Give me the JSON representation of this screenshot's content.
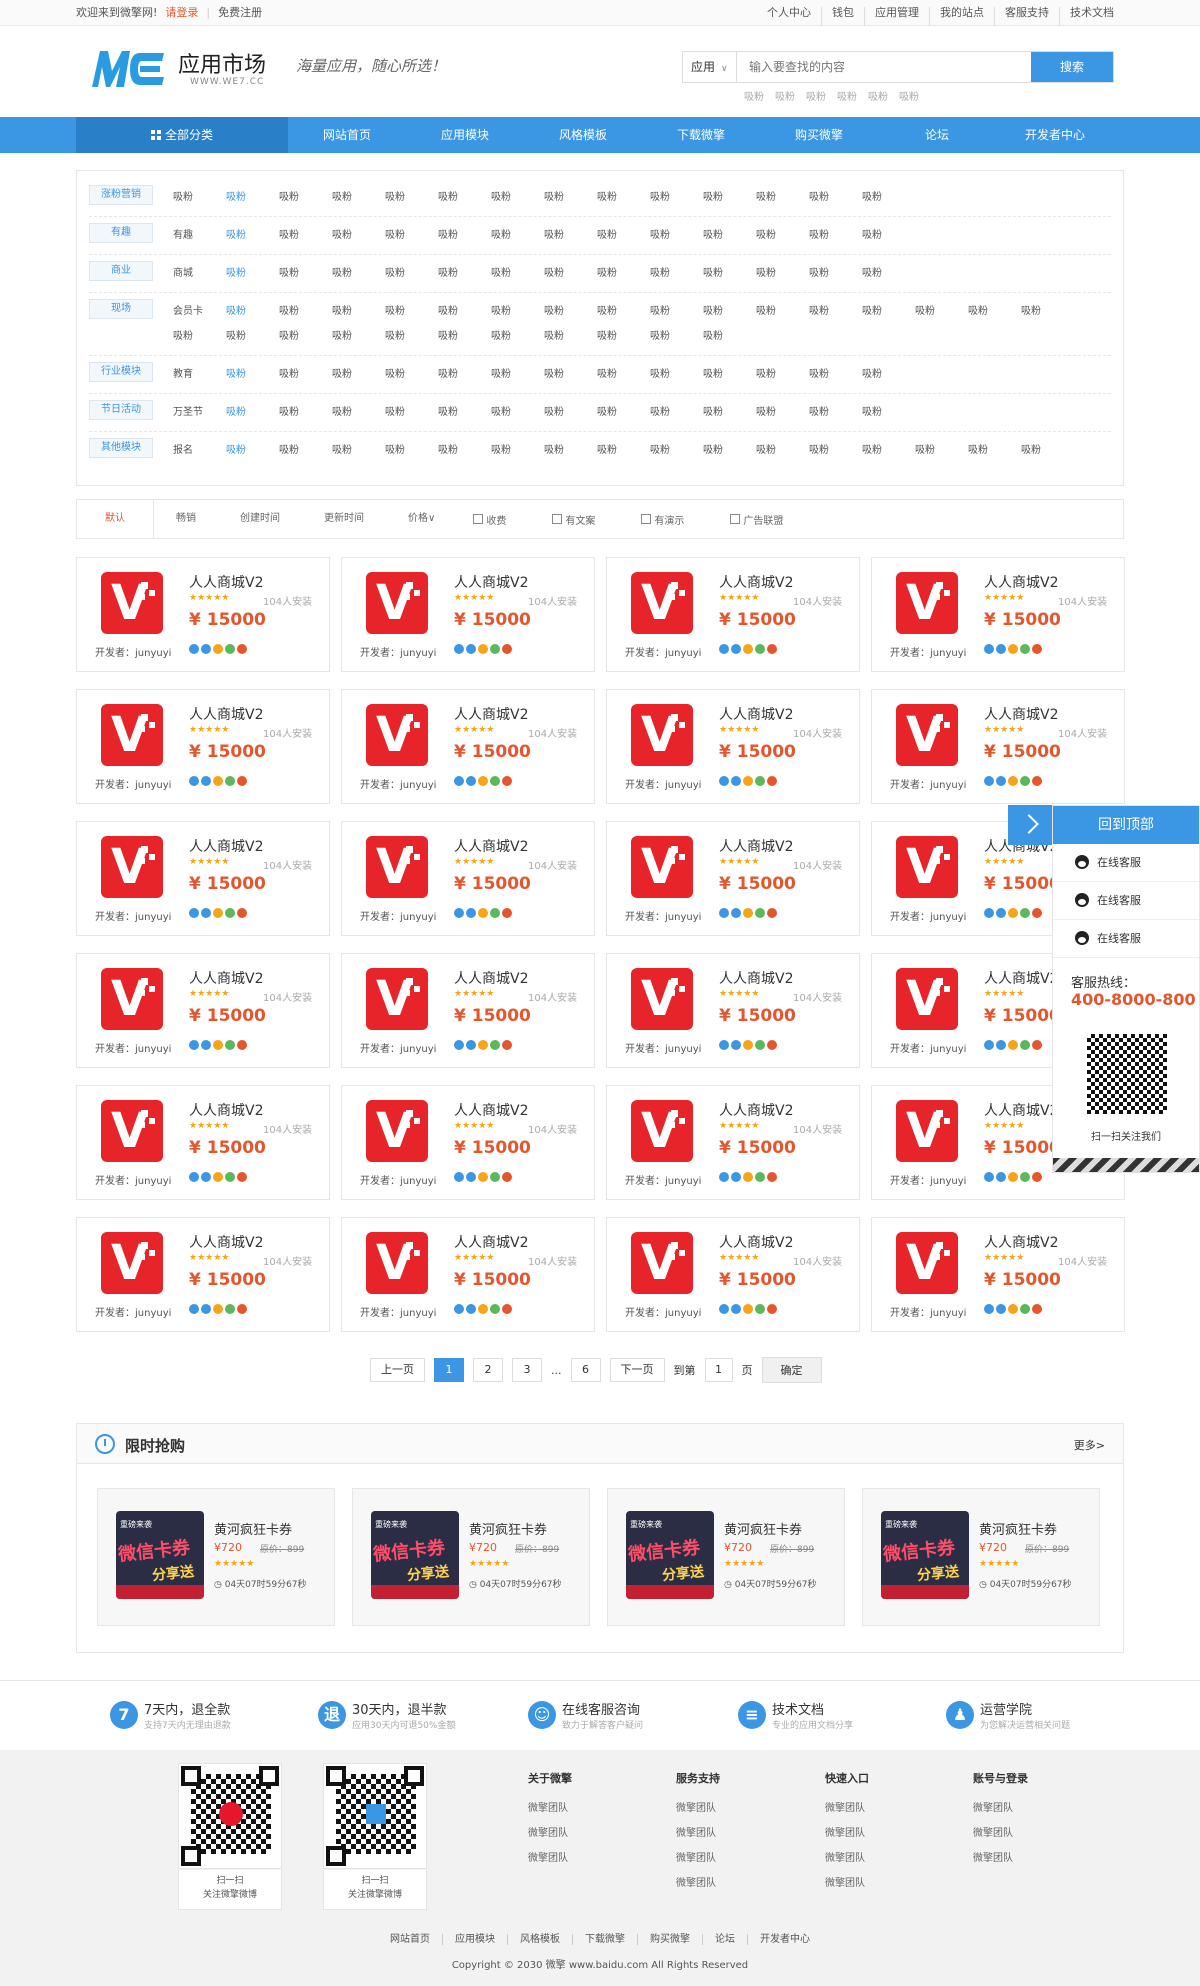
{
  "topbar": {
    "welcome": "欢迎来到微擎网!",
    "login": "请登录",
    "register": "免费注册",
    "links": [
      "个人中心",
      "钱包",
      "应用管理",
      "我的站点",
      "客服支持",
      "技术文档"
    ]
  },
  "header": {
    "logo_text": "应用市场",
    "logo_sub": "WWW.WE7.CC",
    "slogan": "海量应用，随心所选！",
    "search_select": "应用",
    "search_placeholder": "输入要查找的内容",
    "search_button": "搜索",
    "hotwords": [
      "吸粉",
      "吸粉",
      "吸粉",
      "吸粉",
      "吸粉",
      "吸粉"
    ]
  },
  "nav": {
    "items": [
      "全部分类",
      "网站首页",
      "应用模块",
      "风格模板",
      "下载微擎",
      "购买微擎",
      "论坛",
      "开发者中心"
    ]
  },
  "categories": [
    {
      "label": "涨粉营销",
      "items": [
        "吸粉",
        "吸粉",
        "吸粉",
        "吸粉",
        "吸粉",
        "吸粉",
        "吸粉",
        "吸粉",
        "吸粉",
        "吸粉",
        "吸粉",
        "吸粉",
        "吸粉",
        "吸粉"
      ]
    },
    {
      "label": "有趣",
      "items": [
        "有趣",
        "吸粉",
        "吸粉",
        "吸粉",
        "吸粉",
        "吸粉",
        "吸粉",
        "吸粉",
        "吸粉",
        "吸粉",
        "吸粉",
        "吸粉",
        "吸粉",
        "吸粉"
      ]
    },
    {
      "label": "商业",
      "items": [
        "商城",
        "吸粉",
        "吸粉",
        "吸粉",
        "吸粉",
        "吸粉",
        "吸粉",
        "吸粉",
        "吸粉",
        "吸粉",
        "吸粉",
        "吸粉",
        "吸粉",
        "吸粉"
      ]
    },
    {
      "label": "现场",
      "items": [
        "会员卡",
        "吸粉",
        "吸粉",
        "吸粉",
        "吸粉",
        "吸粉",
        "吸粉",
        "吸粉",
        "吸粉",
        "吸粉",
        "吸粉",
        "吸粉",
        "吸粉",
        "吸粉",
        "吸粉",
        "吸粉",
        "吸粉",
        "吸粉",
        "吸粉",
        "吸粉",
        "吸粉",
        "吸粉",
        "吸粉",
        "吸粉",
        "吸粉",
        "吸粉",
        "吸粉",
        "吸粉"
      ]
    },
    {
      "label": "行业模块",
      "items": [
        "教育",
        "吸粉",
        "吸粉",
        "吸粉",
        "吸粉",
        "吸粉",
        "吸粉",
        "吸粉",
        "吸粉",
        "吸粉",
        "吸粉",
        "吸粉",
        "吸粉",
        "吸粉"
      ]
    },
    {
      "label": "节日活动",
      "items": [
        "万圣节",
        "吸粉",
        "吸粉",
        "吸粉",
        "吸粉",
        "吸粉",
        "吸粉",
        "吸粉",
        "吸粉",
        "吸粉",
        "吸粉",
        "吸粉",
        "吸粉",
        "吸粉"
      ]
    },
    {
      "label": "其他模块",
      "items": [
        "报名",
        "吸粉",
        "吸粉",
        "吸粉",
        "吸粉",
        "吸粉",
        "吸粉",
        "吸粉",
        "吸粉",
        "吸粉",
        "吸粉",
        "吸粉",
        "吸粉",
        "吸粉",
        "吸粉",
        "吸粉",
        "吸粉"
      ]
    }
  ],
  "filter": {
    "sorts": [
      "默认",
      "畅销",
      "创建时间",
      "更新时间",
      "价格∨"
    ],
    "checks": [
      "收费",
      "有文案",
      "有演示",
      "广告联盟"
    ]
  },
  "product": {
    "name": "人人商城V2",
    "stars": "★★★★★",
    "installs": "104人安装",
    "price": "¥ 15000",
    "developer": "开发者：junyuyi"
  },
  "pager": {
    "prev": "上一页",
    "pages": [
      "1",
      "2",
      "3"
    ],
    "ellipsis": "...",
    "last": "6",
    "next": "下一页",
    "goto_prefix": "到第",
    "goto_value": "1",
    "goto_suffix": "页",
    "confirm": "确定"
  },
  "flash": {
    "title": "限时抢购",
    "more": "更多>",
    "item": {
      "name": "黄河疯狂卡券",
      "price": "¥720",
      "original": "原价：899",
      "stars": "★★★★★",
      "countdown": "04天07时59分67秒",
      "img_top": "重磅来袭",
      "img_main": "微信卡券",
      "img_sub": "分享送"
    }
  },
  "services": [
    {
      "icon": "7",
      "title": "7天内，退全款",
      "sub": "支持7天内无理由退款"
    },
    {
      "icon": "退",
      "title": "30天内，退半款",
      "sub": "应用30天内可退50%金额"
    },
    {
      "icon": "☺",
      "title": "在线客服咨询",
      "sub": "致力于解答客户疑问"
    },
    {
      "icon": "≡",
      "title": "技术文档",
      "sub": "专业的应用文档分享"
    },
    {
      "icon": "♟",
      "title": "运营学院",
      "sub": "为您解决运营相关问题"
    }
  ],
  "footer": {
    "qr": [
      {
        "line1": "扫一扫",
        "line2": "关注微擎微博"
      },
      {
        "line1": "扫一扫",
        "line2": "关注微擎微博"
      }
    ],
    "columns": [
      {
        "title": "关于微擎",
        "links": [
          "微擎团队",
          "微擎团队",
          "微擎团队"
        ]
      },
      {
        "title": "服务支持",
        "links": [
          "微擎团队",
          "微擎团队",
          "微擎团队",
          "微擎团队"
        ]
      },
      {
        "title": "快速入口",
        "links": [
          "微擎团队",
          "微擎团队",
          "微擎团队",
          "微擎团队"
        ]
      },
      {
        "title": "账号与登录",
        "links": [
          "微擎团队",
          "微擎团队",
          "微擎团队"
        ]
      }
    ],
    "bottom_links": [
      "网站首页",
      "应用模块",
      "风格模板",
      "下载微擎",
      "购买微擎",
      "论坛",
      "开发者中心"
    ],
    "copyright": "Copyright © 2030 微擎 www.baidu.com All Rights Reserved"
  },
  "float": {
    "top": "回到顶部",
    "kf": [
      "在线客服",
      "在线客服",
      "在线客服"
    ],
    "hotline_label": "客服热线：",
    "hotline": "400-8000-800",
    "qr_caption": "扫一扫关注我们"
  },
  "colors": {
    "accent": "#3b96e3",
    "price": "#e4572e",
    "star": "#f7a419",
    "app_icon": "#e72429"
  }
}
